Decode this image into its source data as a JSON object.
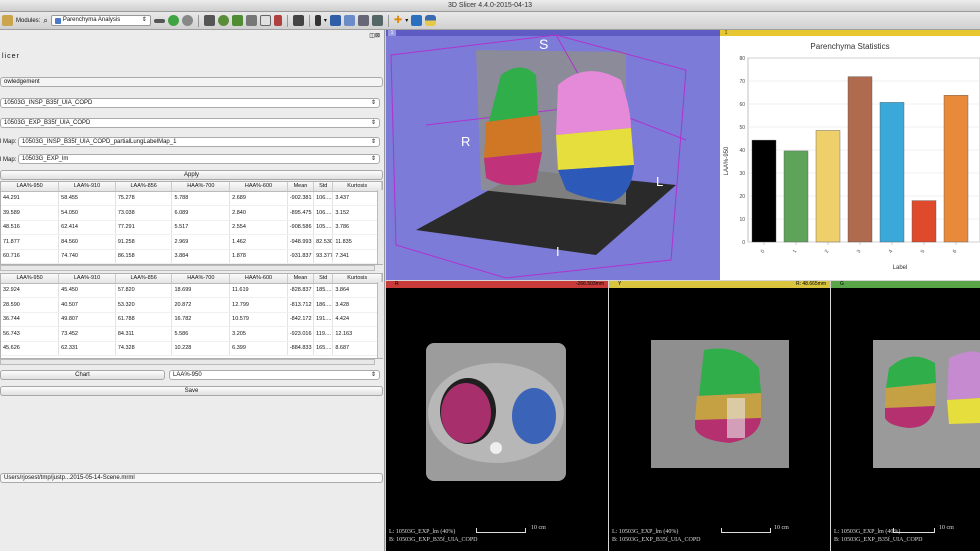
{
  "window": {
    "title": "3D Slicer 4.4.0-2015-04-13"
  },
  "toolbar": {
    "modules_label": "Modules:",
    "module_selected": "Parenchyma Analysis"
  },
  "panel": {
    "title_fragment": "licer",
    "acknowledgement": "owledgement",
    "input1": "10503G_INSP_B35f_UIA_COPD",
    "input2": "10503G_EXP_B35f_UIA_COPD",
    "labelmap_label": "l Map:",
    "labelmap_value": "10503G_INSP_B35f_UIA_COPD_partialLungLabelMap_1",
    "labelmap2_label": "l Map:",
    "labelmap2_value": "10503G_EXP_lm",
    "apply": "Apply",
    "table1": {
      "headers": [
        "LAA%-950",
        "LAA%-910",
        "LAA%-856",
        "HAA%-700",
        "HAA%-600",
        "Mean",
        "Std",
        "Kurtosis"
      ],
      "rows": [
        [
          "44.291",
          "58.455",
          "75.278",
          "5.788",
          "2.689",
          "-902.381",
          "106....",
          "3.437"
        ],
        [
          "39.589",
          "54.050",
          "73.038",
          "6.089",
          "2.840",
          "-895.475",
          "106....",
          "3.152"
        ],
        [
          "48.516",
          "62.414",
          "77.291",
          "5.517",
          "2.554",
          "-908.586",
          "105....",
          "3.786"
        ],
        [
          "71.877",
          "84.560",
          "91.258",
          "2.969",
          "1.462",
          "-948.993",
          "82.530",
          "11.835"
        ],
        [
          "60.716",
          "74.740",
          "86.158",
          "3.884",
          "1.878",
          "-931.837",
          "93.377",
          "7.341"
        ]
      ]
    },
    "table2": {
      "headers": [
        "LAA%-950",
        "LAA%-910",
        "LAA%-856",
        "HAA%-700",
        "HAA%-600",
        "Mean",
        "Std",
        "Kurtosis"
      ],
      "rows": [
        [
          "32.924",
          "45.450",
          "57.820",
          "18.699",
          "11.619",
          "-828.837",
          "185....",
          "3.864"
        ],
        [
          "28.590",
          "40.507",
          "53.320",
          "20.872",
          "12.799",
          "-813.712",
          "186....",
          "3.428"
        ],
        [
          "36.744",
          "49.807",
          "61.788",
          "16.782",
          "10.579",
          "-842.172",
          "191....",
          "4.424"
        ],
        [
          "56.743",
          "73.452",
          "84.311",
          "5.586",
          "3.205",
          "-923.016",
          "119....",
          "12.163"
        ],
        [
          "45.626",
          "62.331",
          "74.328",
          "10.228",
          "6.399",
          "-884.833",
          "165....",
          "8.687"
        ]
      ]
    },
    "chart_button": "Chart",
    "chart_select": "LAA%-950",
    "save": "Save",
    "scene_path": "Users/rjosest/tmp/justp...2015-05-14-Scene.mrml"
  },
  "view3d": {
    "label_s": "S",
    "label_r": "R",
    "label_l": "L",
    "label_i": "I",
    "badge": "1"
  },
  "chartview": {
    "badge": "1"
  },
  "chart_data": {
    "type": "bar",
    "title": "Parenchyma Statistics",
    "xlabel": "Label",
    "ylabel": "LAA%-950",
    "ylim": [
      0,
      80
    ],
    "yticks": [
      0,
      10,
      20,
      30,
      40,
      50,
      60,
      70,
      80
    ],
    "categories": [
      "0",
      "1",
      "2",
      "3",
      "4",
      "5",
      "6"
    ],
    "values": [
      44.3,
      39.6,
      48.5,
      71.9,
      60.7,
      18.0,
      63.8
    ],
    "colors": [
      "#000000",
      "#5fa35a",
      "#efcf6a",
      "#b06a4e",
      "#3aa8d8",
      "#e04a2c",
      "#e9893a"
    ]
  },
  "slices": [
    {
      "id": "R",
      "value": "-266.503mm",
      "color": "#c73b3b",
      "line1": "L: 10503G_EXP_lm (40%)",
      "line2": "B: 10503G_EXP_B35f_UIA_COPD",
      "scale": "10 cm"
    },
    {
      "id": "Y",
      "value": "R: 48.665mm",
      "color": "#d9c440",
      "line1": "L: 10503G_EXP_lm (40%)",
      "line2": "B: 10503G_EXP_B35f_UIA_COPD",
      "scale": "10 cm"
    },
    {
      "id": "G",
      "value": "",
      "color": "#5aa54a",
      "line1": "L: 10503G_EXP_lm (40%)",
      "line2": "B: 10503G_EXP_B35f_UIA_COPD",
      "scale": "10 cm"
    }
  ]
}
